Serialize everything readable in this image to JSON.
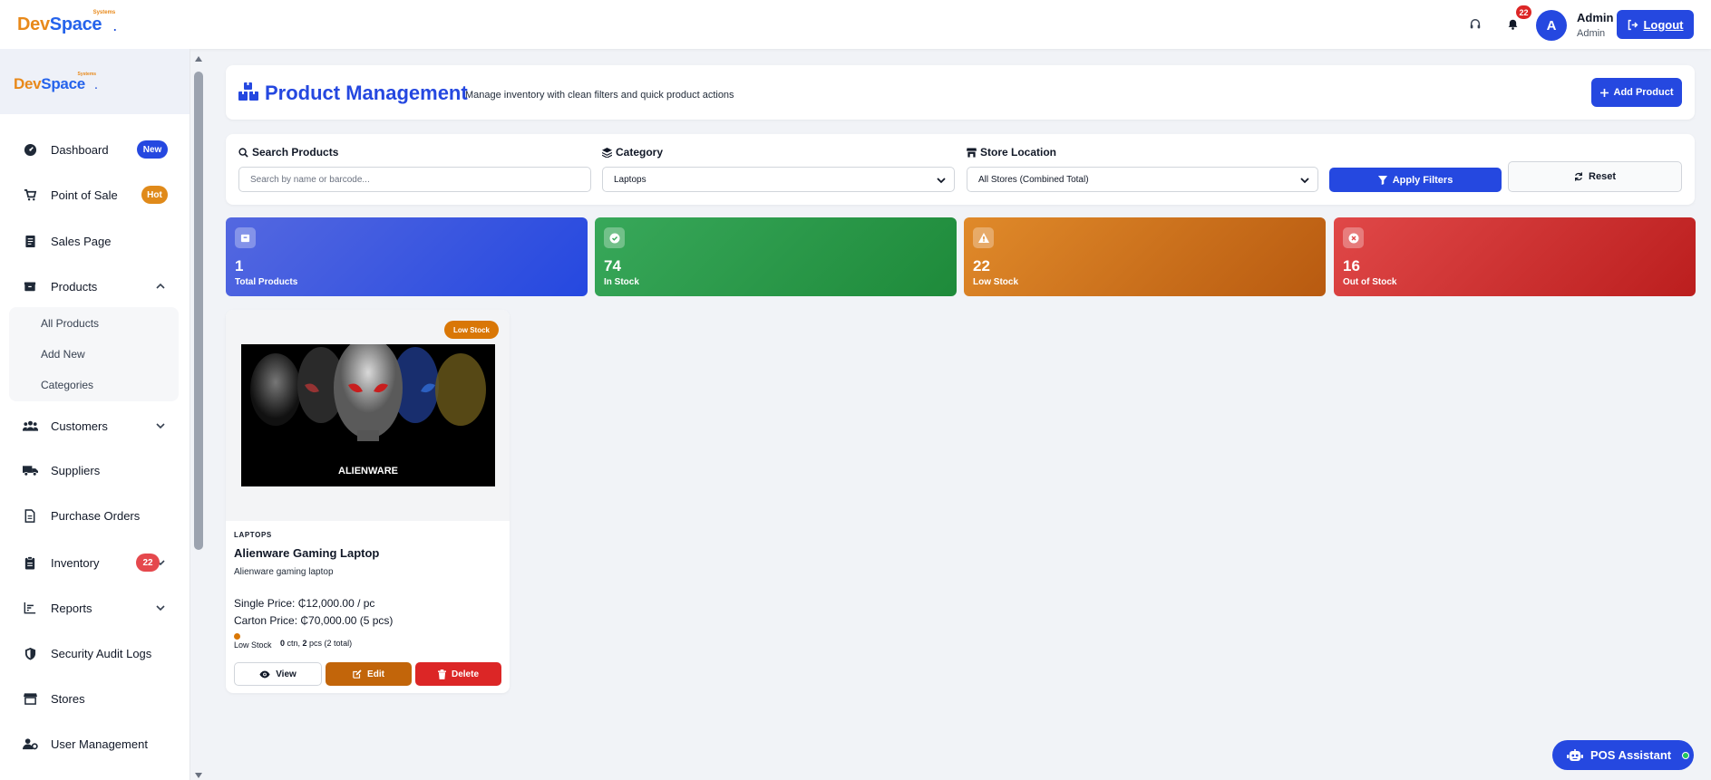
{
  "brand": {
    "part1": "Dev",
    "part2": "Space",
    "tag": "Systems",
    "dot": "."
  },
  "topbar": {
    "notification_count": "22",
    "avatar_initial": "A",
    "user_name": "Admin",
    "user_role": "Admin",
    "logout_label": "Logout"
  },
  "sidebar": {
    "items": [
      {
        "label": "Dashboard",
        "icon": "gauge-icon",
        "badge": "New"
      },
      {
        "label": "Point of Sale",
        "icon": "cart-icon",
        "badge": "Hot"
      },
      {
        "label": "Sales Page",
        "icon": "receipt-icon"
      },
      {
        "label": "Products",
        "icon": "box-icon"
      },
      {
        "label": "Customers",
        "icon": "users-icon"
      },
      {
        "label": "Suppliers",
        "icon": "truck-icon"
      },
      {
        "label": "Purchase Orders",
        "icon": "file-invoice-icon"
      },
      {
        "label": "Inventory",
        "icon": "clipboard-icon",
        "badge": "22"
      },
      {
        "label": "Reports",
        "icon": "chart-icon"
      },
      {
        "label": "Security Audit Logs",
        "icon": "shield-icon"
      },
      {
        "label": "Stores",
        "icon": "store-icon"
      },
      {
        "label": "User Management",
        "icon": "user-cog-icon"
      }
    ],
    "products_sub": [
      "All Products",
      "Add New",
      "Categories"
    ]
  },
  "header": {
    "title": "Product Management",
    "subtitle": "Manage inventory with clean filters and quick product actions",
    "add_button": "Add Product"
  },
  "filters": {
    "search_label": "Search Products",
    "search_placeholder": "Search by name or barcode...",
    "category_label": "Category",
    "category_value": "Laptops",
    "store_label": "Store Location",
    "store_value": "All Stores (Combined Total)",
    "apply_label": "Apply Filters",
    "reset_label": "Reset"
  },
  "stats": [
    {
      "value": "1",
      "label": "Total Products",
      "color_from": "#5468e0",
      "color_to": "#2548e0"
    },
    {
      "value": "74",
      "label": "In Stock",
      "color_from": "#38a85a",
      "color_to": "#1e8a3a"
    },
    {
      "value": "22",
      "label": "Low Stock",
      "color_from": "#e08a2a",
      "color_to": "#b85a10"
    },
    {
      "value": "16",
      "label": "Out of Stock",
      "color_from": "#e04848",
      "color_to": "#bb1e1e"
    }
  ],
  "product": {
    "badge": "Low Stock",
    "category": "LAPTOPS",
    "name": "Alienware Gaming Laptop",
    "description": "Alienware gaming laptop",
    "single_price": "Single Price: ₵12,000.00 / pc",
    "carton_price": "Carton Price: ₵70,000.00 (5 pcs)",
    "stock_status": "Low Stock",
    "stock_ctn": "0",
    "stock_ctn_unit": " ctn, ",
    "stock_pcs": "2",
    "stock_pcs_unit": " pcs (2 total)",
    "image_logo_text": "ALIENWARE",
    "view_label": "View",
    "edit_label": "Edit",
    "delete_label": "Delete"
  },
  "assistant": {
    "label": "POS Assistant"
  }
}
